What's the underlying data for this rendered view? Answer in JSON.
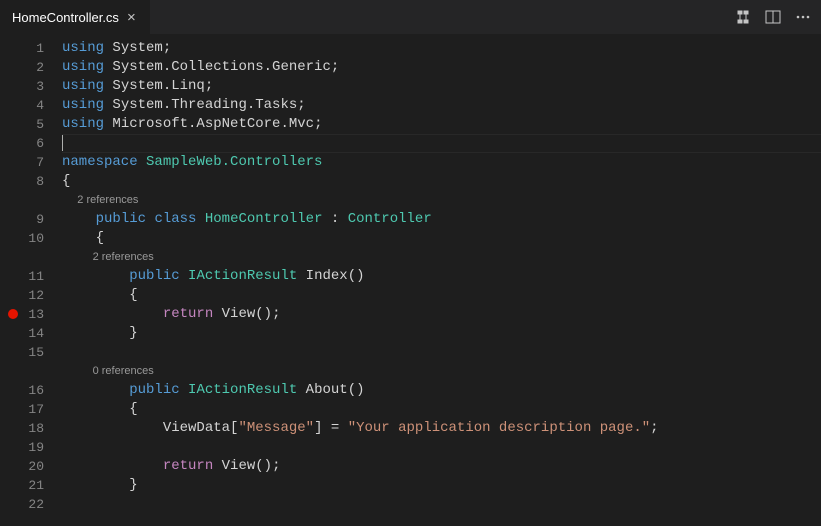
{
  "tab": {
    "title": "HomeController.cs"
  },
  "lineNumbers": [
    "1",
    "2",
    "3",
    "4",
    "5",
    "6",
    "7",
    "8",
    "9",
    "10",
    "11",
    "12",
    "13",
    "14",
    "15",
    "16",
    "17",
    "18",
    "19",
    "20",
    "21",
    "22"
  ],
  "breakpoint": {
    "line": 13
  },
  "cursor": {
    "line": 6
  },
  "codelens": {
    "class": "2 references",
    "index": "2 references",
    "about": "0 references"
  },
  "tokens": {
    "using": "using",
    "namespace": "namespace",
    "public": "public",
    "class": "class",
    "return": "return",
    "System": "System",
    "CollectionsGeneric": "System.Collections.Generic",
    "Linq": "System.Linq",
    "ThreadingTasks": "System.Threading.Tasks",
    "Mvc": "Microsoft.AspNetCore.Mvc",
    "NamespaceName": "SampleWeb.Controllers",
    "HomeController": "HomeController",
    "Controller": "Controller",
    "IActionResult": "IActionResult",
    "Index": "Index",
    "About": "About",
    "View": "View",
    "ViewData": "ViewData",
    "MessageKey": "\"Message\"",
    "MessageVal": "\"Your application description page.\""
  }
}
